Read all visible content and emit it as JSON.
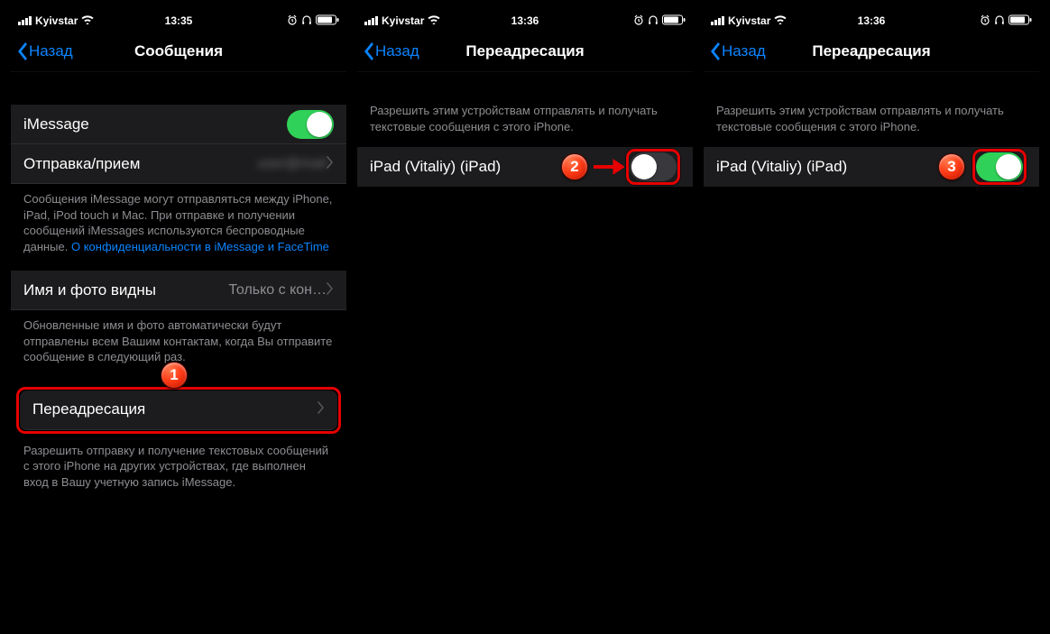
{
  "screen1": {
    "status": {
      "carrier": "Kyivstar",
      "time": "13:35"
    },
    "nav": {
      "back": "Назад",
      "title": "Сообщения"
    },
    "imessage_label": "iMessage",
    "sendreceive_label": "Отправка/прием",
    "sendreceive_detail": "user@mail",
    "footer1_text": "Сообщения iMessage могут отправляться между iPhone, iPad, iPod touch и Mac. При отправке и получении сообщений iMessages используются беспроводные данные. ",
    "footer1_link": "О конфиденциальности в iMessage и FaceTime",
    "namephoto_label": "Имя и фото видны",
    "namephoto_detail": "Только с кон…",
    "footer2_text": "Обновленные имя и фото автоматически будут отправлены всем Вашим контактам, когда Вы отправите сообщение в следующий раз.",
    "forwarding_label": "Переадресация",
    "footer3_text": "Разрешить отправку и получение текстовых сообщений с этого iPhone на других устройствах, где выполнен вход в Вашу учетную запись iMessage.",
    "badge": "1"
  },
  "screen2": {
    "status": {
      "carrier": "Kyivstar",
      "time": "13:36"
    },
    "nav": {
      "back": "Назад",
      "title": "Переадресация"
    },
    "header_text": "Разрешить этим устройствам отправлять и получать текстовые сообщения с этого iPhone.",
    "device_label": "iPad (Vitaliy) (iPad)",
    "badge": "2"
  },
  "screen3": {
    "status": {
      "carrier": "Kyivstar",
      "time": "13:36"
    },
    "nav": {
      "back": "Назад",
      "title": "Переадресация"
    },
    "header_text": "Разрешить этим устройствам отправлять и получать текстовые сообщения с этого iPhone.",
    "device_label": "iPad (Vitaliy) (iPad)",
    "badge": "3"
  }
}
